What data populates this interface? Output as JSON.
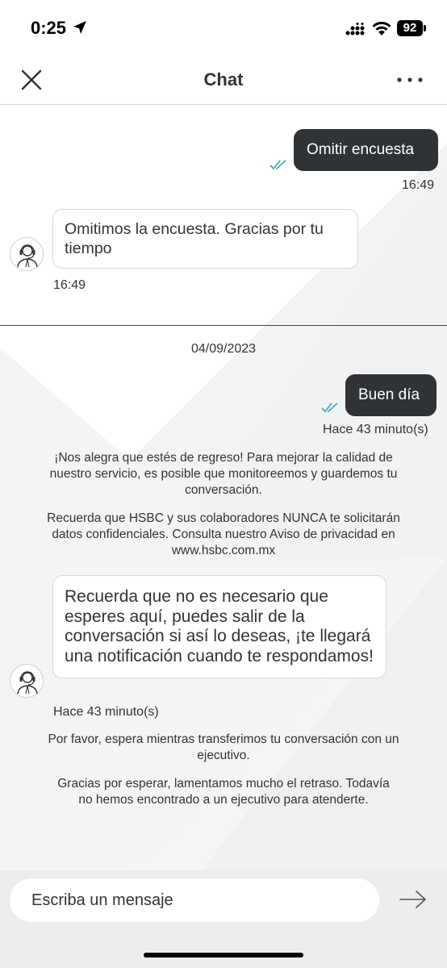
{
  "status_bar": {
    "time": "0:25",
    "battery": "92"
  },
  "header": {
    "title": "Chat"
  },
  "messages": {
    "user_1": {
      "text": "Omitir encuesta",
      "time": "16:49"
    },
    "bot_1": {
      "text": "Omitimos la encuesta. Gracias por tu tiempo",
      "time": "16:49"
    },
    "date": "04/09/2023",
    "user_2": {
      "text": "Buen día",
      "time": "Hace 43 minuto(s)"
    },
    "system_1": "¡Nos alegra que estés de regreso! Para mejorar la calidad de nuestro servicio, es posible que monitoreemos y guardemos tu conversación.",
    "system_2": "Recuerda que HSBC y sus colaboradores NUNCA te solicitarán datos confidenciales. Consulta nuestro Aviso de privacidad en www.hsbc.com.mx",
    "bot_2": {
      "text": "Recuerda que no es necesario que esperes aquí, puedes salir de la conversación si así lo deseas, ¡te llegará una notificación cuando te respondamos!",
      "time": "Hace 43 minuto(s)"
    },
    "system_3": "Por favor, espera mientras transferimos tu conversación con un ejecutivo.",
    "system_4": "Gracias por esperar, lamentamos mucho el retraso. Todavía no hemos encontrado a un ejecutivo para atenderte."
  },
  "composer": {
    "placeholder": "Escriba un mensaje"
  },
  "icons": {
    "close": "close-icon",
    "more": "more-options-icon",
    "send": "arrow-right-icon",
    "read": "double-check-icon",
    "agent": "headset-agent-icon"
  },
  "colors": {
    "user_bubble": "#2f3336",
    "read_check": "#3fa6b5",
    "input_bar": "#ececec"
  }
}
